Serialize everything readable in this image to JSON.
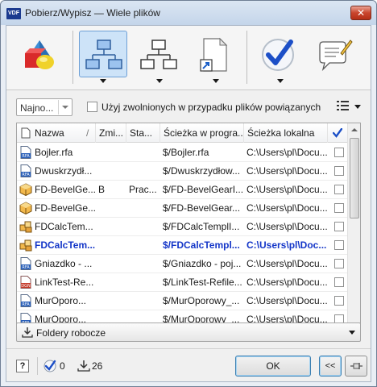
{
  "window": {
    "app_icon_text": "VDF",
    "title": "Pobierz/Wypisz — Wiele plików",
    "close_glyph": "✕"
  },
  "toolbar": {
    "buttons": [
      {
        "name": "options-icon",
        "active": false,
        "has_dropdown": false
      },
      {
        "name": "hierarchy-icon",
        "active": true,
        "has_dropdown": true
      },
      {
        "name": "hierarchy-alt-icon",
        "active": false,
        "has_dropdown": true
      },
      {
        "name": "shortcut-file-icon",
        "active": false,
        "has_dropdown": true
      },
      {
        "name": "checkmark-icon",
        "active": false,
        "has_dropdown": true
      },
      {
        "name": "comment-icon",
        "active": false,
        "has_dropdown": false
      }
    ]
  },
  "filter": {
    "version_combo": "Najno...",
    "use_released_label": "Użyj zwolnionych w przypadku plików powiązanych",
    "use_released_checked": false
  },
  "grid": {
    "columns": [
      "Nazwa",
      "Zmi...",
      "Sta...",
      "Ścieżka w progra...",
      "Ścieżka lokalna"
    ],
    "sort_indicator": "/",
    "check_column_icon": "checkmark-icon",
    "rows": [
      {
        "icon": "rfa",
        "name": "Bojler.rfa",
        "change": "",
        "state": "",
        "vault_path": "$/Bojler.rfa",
        "local_path": "C:\\Users\\pl\\Docu...",
        "checked": false,
        "bold": false
      },
      {
        "icon": "rfa",
        "name": "Dwuskrzydł...",
        "change": "",
        "state": "",
        "vault_path": "$/Dwuskrzydłow...",
        "local_path": "C:\\Users\\pl\\Docu...",
        "checked": false,
        "bold": false
      },
      {
        "icon": "cube",
        "name": "FD-BevelGe...",
        "change": "B",
        "state": "Prac...",
        "vault_path": "$/FD-BevelGearI...",
        "local_path": "C:\\Users\\pl\\Docu...",
        "checked": false,
        "bold": false
      },
      {
        "icon": "cube",
        "name": "FD-BevelGe...",
        "change": "",
        "state": "",
        "vault_path": "$/FD-BevelGear...",
        "local_path": "C:\\Users\\pl\\Docu...",
        "checked": false,
        "bold": false
      },
      {
        "icon": "assembly",
        "name": "FDCalcTem...",
        "change": "",
        "state": "",
        "vault_path": "$/FDCalcTemplI...",
        "local_path": "C:\\Users\\pl\\Docu...",
        "checked": false,
        "bold": false
      },
      {
        "icon": "assembly",
        "name": "FDCalcTem...",
        "change": "",
        "state": "",
        "vault_path": "$/FDCalcTempl...",
        "local_path": "C:\\Users\\pl\\Doc...",
        "checked": false,
        "bold": true
      },
      {
        "icon": "rfa",
        "name": "Gniazdko - ...",
        "change": "",
        "state": "",
        "vault_path": "$/Gniazdko - poj...",
        "local_path": "C:\\Users\\pl\\Docu...",
        "checked": false,
        "bold": false
      },
      {
        "icon": "dgn",
        "name": "LinkTest-Re...",
        "change": "",
        "state": "",
        "vault_path": "$/LinkTest-Refile...",
        "local_path": "C:\\Users\\pl\\Docu...",
        "checked": false,
        "bold": false
      },
      {
        "icon": "rfa",
        "name": "MurOporo...",
        "change": "",
        "state": "",
        "vault_path": "$/MurOporowy_...",
        "local_path": "C:\\Users\\pl\\Docu...",
        "checked": false,
        "bold": false
      },
      {
        "icon": "rfa",
        "name": "MurOporo...",
        "change": "",
        "state": "",
        "vault_path": "$/MurOporowy_...",
        "local_path": "C:\\Users\\pl\\Docu...",
        "checked": false,
        "bold": false
      }
    ]
  },
  "workspace": {
    "label": "Foldery robocze"
  },
  "footer": {
    "help_label": "?",
    "checked_count": "0",
    "download_count": "26",
    "ok_label": "OK",
    "collapse_label": "<<"
  }
}
